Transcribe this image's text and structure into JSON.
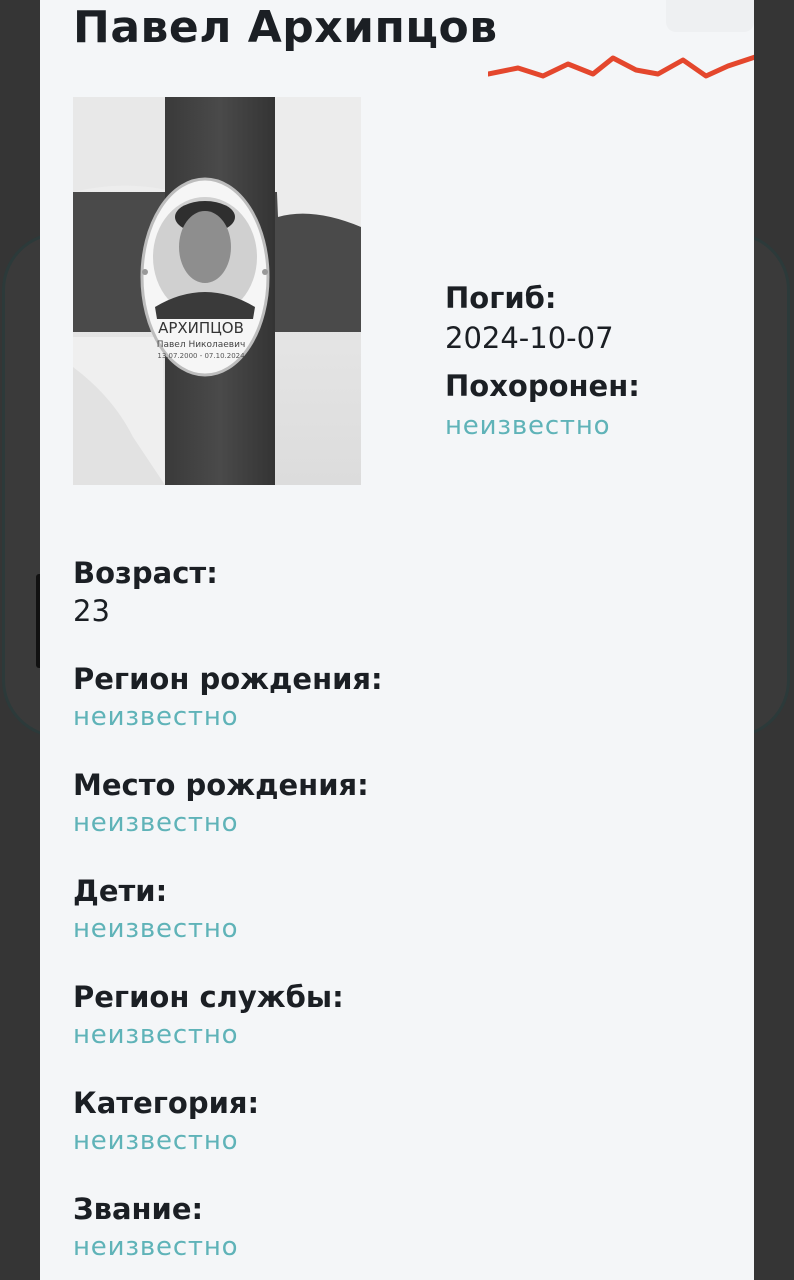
{
  "person": {
    "name": "Павел Архипцов"
  },
  "death": {
    "died_label": "Погиб:",
    "died_value": "2024-10-07",
    "buried_label": "Похоронен:",
    "buried_value": "неизвестно"
  },
  "details": [
    {
      "label": "Возраст:",
      "value": "23"
    },
    {
      "label": "Регион рождения:",
      "value": "неизвестно"
    },
    {
      "label": "Место рождения:",
      "value": "неизвестно"
    },
    {
      "label": "Дети:",
      "value": "неизвестно"
    },
    {
      "label": "Регион службы:",
      "value": "неизвестно"
    },
    {
      "label": "Категория:",
      "value": "неизвестно"
    },
    {
      "label": "Звание:",
      "value": "неизвестно"
    }
  ],
  "photo": {
    "plaque_name": "АРХИПЦОВ",
    "plaque_sub": "Павел Николаевич",
    "plaque_dates": "13.07.2000 - 07.10.2024"
  },
  "colors": {
    "accent_wave": "#e4472d",
    "unknown_text": "#5fb3b8",
    "text": "#1b1f24",
    "modal_bg": "#f4f6f8"
  },
  "icons": {
    "close": "close-icon",
    "decor": "zigzag-decoration"
  }
}
